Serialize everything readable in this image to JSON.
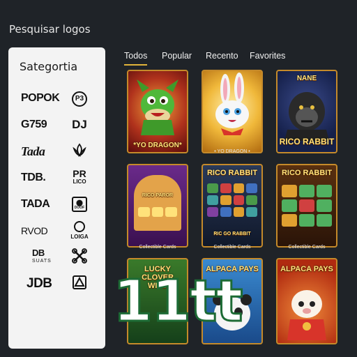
{
  "header": {
    "title": "Pesquisar logos"
  },
  "sidebar": {
    "title": "Sategortia",
    "logos": [
      {
        "left": "POPOK",
        "right": "P3"
      },
      {
        "left": "G759",
        "right": "DJ"
      },
      {
        "left": "Tada",
        "right": "lotus-icon"
      },
      {
        "left": "TDB.",
        "right": "PR",
        "right_sub": "LICO"
      },
      {
        "left": "TADA",
        "right": "DOOF"
      },
      {
        "left": "RVOD",
        "right": "LOIGA"
      },
      {
        "left": "DB",
        "left_sub": "SUATS",
        "right": "clover-cross-icon"
      },
      {
        "left": "JDB",
        "right": "triangle-box-icon"
      }
    ]
  },
  "tabs": [
    {
      "label": "Todos",
      "active": true
    },
    {
      "label": "Popular",
      "active": false
    },
    {
      "label": "Recento",
      "active": false
    },
    {
      "label": "Favorites",
      "active": false
    }
  ],
  "cards": [
    {
      "title": "*YO DRAGON*",
      "caption": ""
    },
    {
      "title": "",
      "caption": "• YO DRAGON •"
    },
    {
      "title": "RICO RABBIT",
      "top_label": "NANE",
      "caption": ""
    },
    {
      "title": "RICO PAROR",
      "caption": "Collectible Cards"
    },
    {
      "title": "RICO RABBIT",
      "bottom_label": "RIC GO RABBIT",
      "caption": "Collectible Cards"
    },
    {
      "title": "RICO RABBIT",
      "caption": "Collectible Cards"
    },
    {
      "title": "LUCKY CLOVER WILD",
      "caption": ""
    },
    {
      "title": "ALPACA PAYS",
      "caption": ""
    },
    {
      "title": "ALPACA PAYS",
      "caption": ""
    }
  ],
  "overlay": {
    "text": "11tt"
  },
  "colors": {
    "background": "#1f2328",
    "accent": "#e2b43a",
    "overlay_stroke": "#1d6b35"
  }
}
